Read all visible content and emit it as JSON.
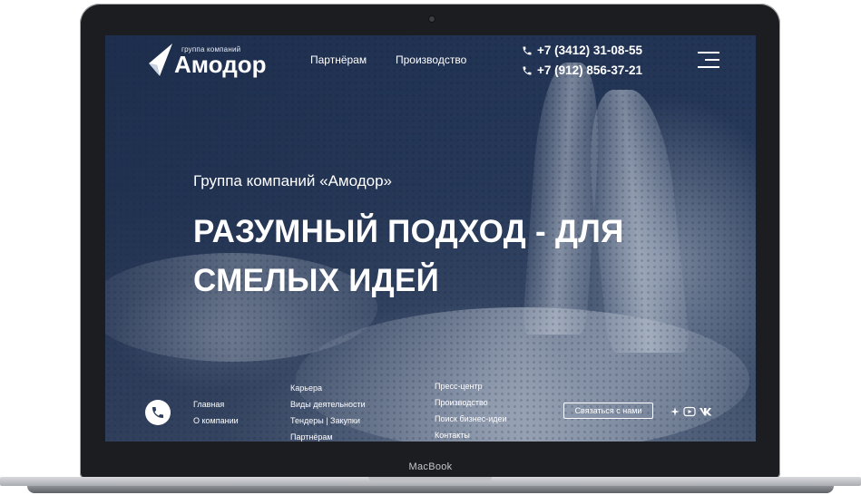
{
  "device": {
    "model_label": "MacBook"
  },
  "header": {
    "logo": {
      "small_text": "группа компаний",
      "brand": "Амодор"
    },
    "nav": [
      {
        "label": "Партнёрам"
      },
      {
        "label": "Производство"
      }
    ],
    "phones": [
      "+7 (3412) 31-08-55",
      "+7 (912) 856-37-21"
    ]
  },
  "hero": {
    "subtitle": "Группа компаний «Амодор»",
    "headline_line1": "РАЗУМНЫЙ ПОДХОД - ДЛЯ",
    "headline_line2": "СМЕЛЫХ ИДЕЙ"
  },
  "footer": {
    "col1": [
      "Главная",
      "О компании"
    ],
    "col2": [
      "Карьера",
      "Виды деятельности",
      "Тендеры | Закупки",
      "Партнёрам"
    ],
    "col3": [
      "Пресс-центр",
      "Производство",
      "Поиск бизнес-идеи",
      "Контакты"
    ],
    "contact_button": "Связаться с нами"
  },
  "icons": [
    "phone-icon",
    "burger-menu-icon",
    "sparkle-icon",
    "youtube-icon",
    "vk-icon"
  ],
  "colors": {
    "background": "#2a3c5c",
    "text": "#ffffff",
    "bezel": "#1c1d20"
  }
}
